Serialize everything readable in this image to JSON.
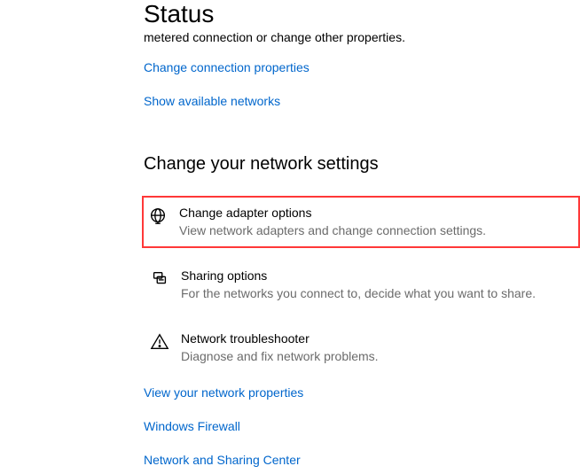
{
  "header": {
    "title": "Status",
    "subtitle": "metered connection or change other properties."
  },
  "topLinks": {
    "changeProps": "Change connection properties",
    "showNetworks": "Show available networks"
  },
  "section": {
    "heading": "Change your network settings",
    "items": [
      {
        "title": "Change adapter options",
        "desc": "View network adapters and change connection settings."
      },
      {
        "title": "Sharing options",
        "desc": "For the networks you connect to, decide what you want to share."
      },
      {
        "title": "Network troubleshooter",
        "desc": "Diagnose and fix network problems."
      }
    ]
  },
  "bottomLinks": {
    "viewProps": "View your network properties",
    "firewall": "Windows Firewall",
    "sharingCenter": "Network and Sharing Center"
  }
}
